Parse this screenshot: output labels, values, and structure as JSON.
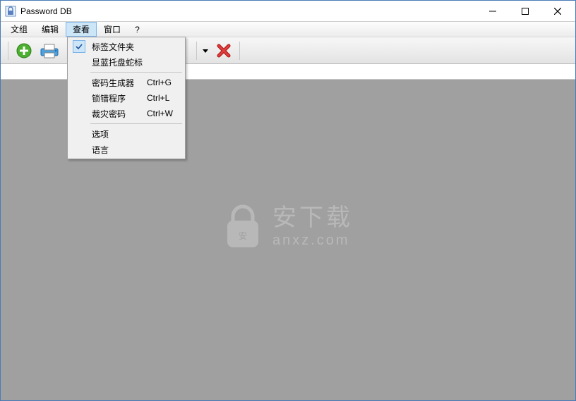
{
  "window": {
    "title": "Password DB"
  },
  "menubar": {
    "items": [
      {
        "label": "文组"
      },
      {
        "label": "编辑"
      },
      {
        "label": "查看"
      },
      {
        "label": "窗口"
      },
      {
        "label": "?"
      }
    ],
    "activeIndex": 2
  },
  "dropdown": {
    "items": [
      {
        "label": "标签文件夹",
        "shortcut": "",
        "checked": true
      },
      {
        "label": "显蓝托盘蛇标",
        "shortcut": "",
        "checked": false
      },
      {
        "separator": true
      },
      {
        "label": "密码生成器",
        "shortcut": "Ctrl+G",
        "checked": false
      },
      {
        "label": "锁错程序",
        "shortcut": "Ctrl+L",
        "checked": false
      },
      {
        "label": "裁灾密码",
        "shortcut": "Ctrl+W",
        "checked": false
      },
      {
        "separator": true
      },
      {
        "label": "选项",
        "shortcut": "",
        "checked": false
      },
      {
        "label": "语言",
        "shortcut": "",
        "checked": false
      }
    ]
  },
  "watermark": {
    "line1": "安下载",
    "line2": "anxz.com"
  }
}
